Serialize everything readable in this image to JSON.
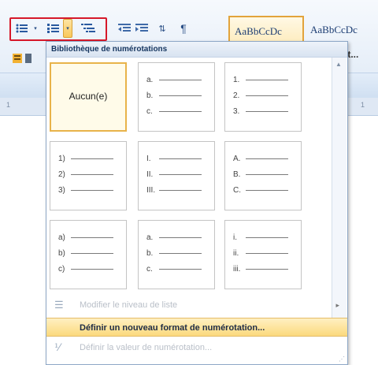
{
  "ribbon": {
    "styles": [
      {
        "label": "AaBbCcDc",
        "active": true
      },
      {
        "label": "AaBbCcDc",
        "active": false
      }
    ],
    "style_label": "nt..."
  },
  "ruler": {
    "marks": [
      "1",
      "1"
    ]
  },
  "panel": {
    "title": "Bibliothèque de numérotations",
    "tiles": [
      {
        "type": "none",
        "label": "Aucun(e)"
      },
      {
        "type": "list",
        "markers": [
          "a.",
          "b.",
          "c."
        ]
      },
      {
        "type": "list",
        "markers": [
          "1.",
          "2.",
          "3."
        ]
      },
      {
        "type": "list",
        "markers": [
          "1)",
          "2)",
          "3)"
        ]
      },
      {
        "type": "list",
        "markers": [
          "I.",
          "II.",
          "III."
        ]
      },
      {
        "type": "list",
        "markers": [
          "A.",
          "B.",
          "C."
        ]
      },
      {
        "type": "list",
        "markers": [
          "a)",
          "b)",
          "c)"
        ]
      },
      {
        "type": "list",
        "markers": [
          "a.",
          "b.",
          "c."
        ]
      },
      {
        "type": "list",
        "markers": [
          "i.",
          "ii.",
          "iii."
        ]
      }
    ],
    "menu": {
      "change_level": "Modifier le niveau de liste",
      "define_format": "Définir un nouveau format de numérotation...",
      "set_value": "Définir la valeur de numérotation..."
    }
  }
}
